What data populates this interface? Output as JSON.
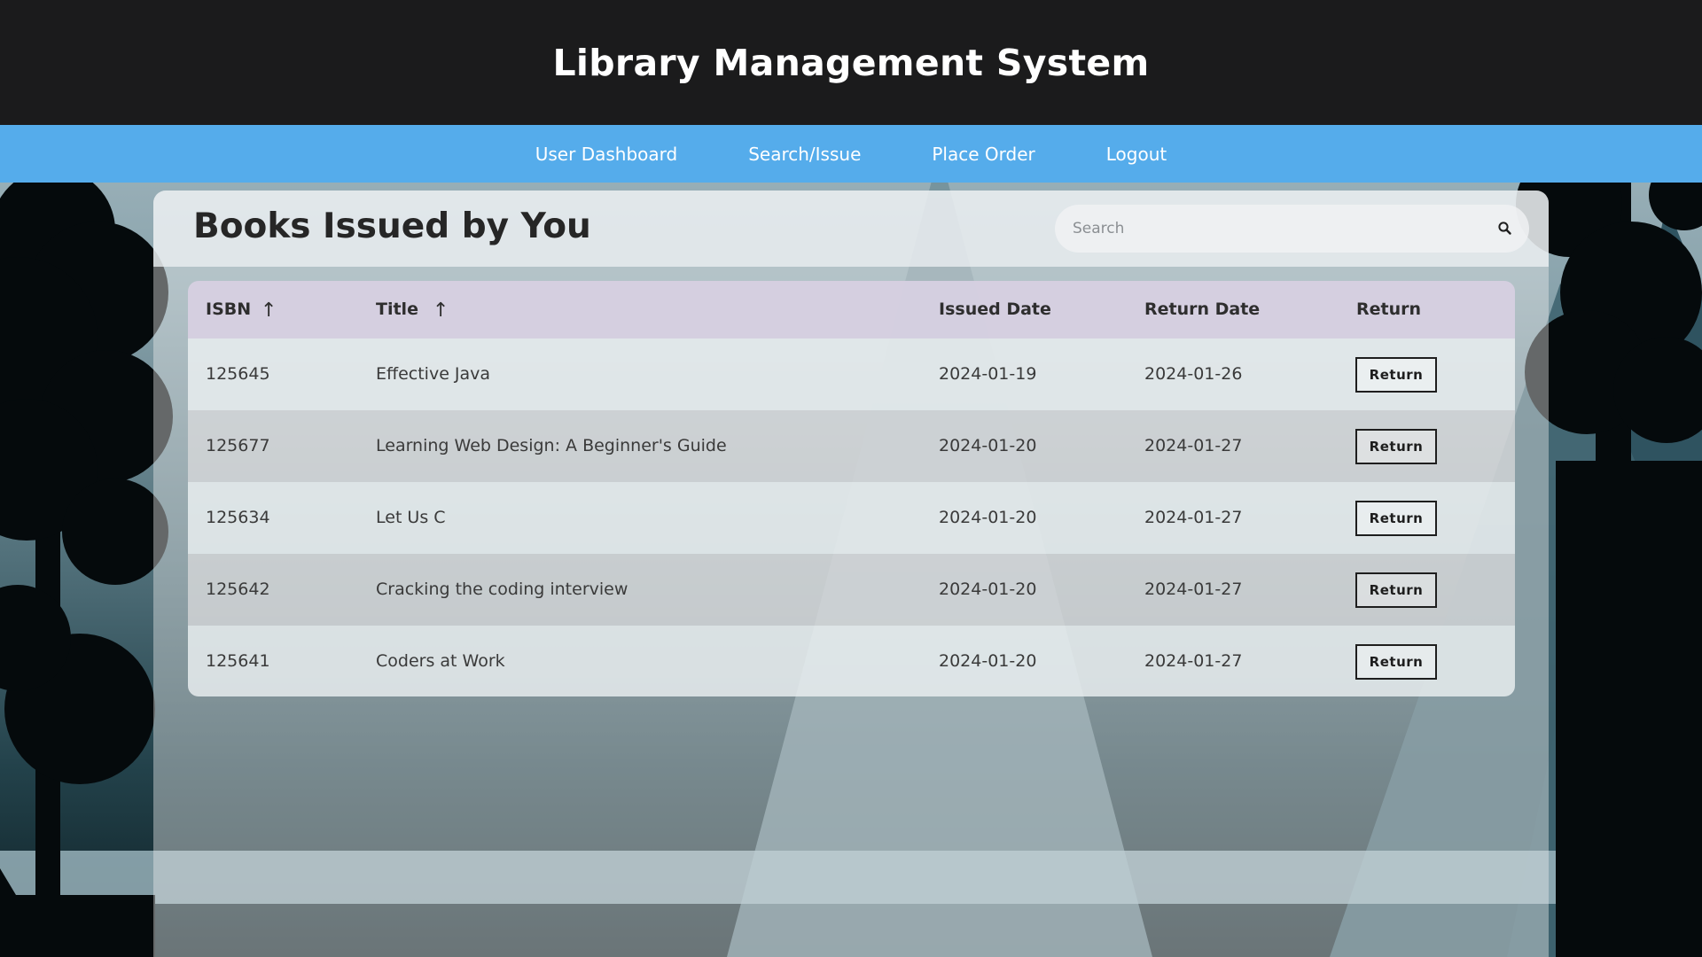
{
  "app": {
    "title": "Library Management System"
  },
  "nav": {
    "items": [
      {
        "label": "User Dashboard"
      },
      {
        "label": "Search/Issue"
      },
      {
        "label": "Place Order"
      },
      {
        "label": "Logout"
      }
    ]
  },
  "panel": {
    "title": "Books Issued by You"
  },
  "search": {
    "placeholder": "Search",
    "icon": "search-icon"
  },
  "table": {
    "columns": {
      "isbn": "ISBN",
      "title": "Title",
      "issued": "Issued Date",
      "returned": "Return Date",
      "action": "Return"
    },
    "sort_arrow": "↑",
    "button_label": "Return",
    "rows": [
      {
        "isbn": "125645",
        "title": "Effective Java",
        "issued": "2024-01-19",
        "returned": "2024-01-26"
      },
      {
        "isbn": "125677",
        "title": "Learning Web Design: A Beginner's Guide",
        "issued": "2024-01-20",
        "returned": "2024-01-27"
      },
      {
        "isbn": "125634",
        "title": "Let Us C",
        "issued": "2024-01-20",
        "returned": "2024-01-27"
      },
      {
        "isbn": "125642",
        "title": "Cracking the coding interview",
        "issued": "2024-01-20",
        "returned": "2024-01-27"
      },
      {
        "isbn": "125641",
        "title": "Coders at Work",
        "issued": "2024-01-20",
        "returned": "2024-01-27"
      }
    ]
  },
  "colors": {
    "header_bg": "#1b1b1c",
    "nav_bg": "#55aceb",
    "table_head_bg": "#d6d0e1"
  }
}
